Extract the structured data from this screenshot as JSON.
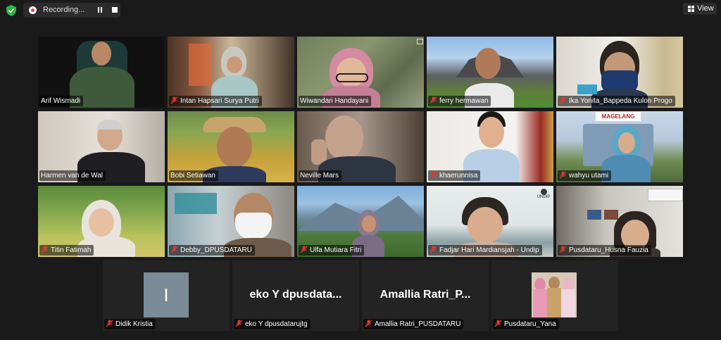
{
  "recording": {
    "label": "Recording..."
  },
  "view": {
    "label": "View"
  },
  "participants": [
    {
      "name": "Arif Wismadi",
      "muted": false
    },
    {
      "name": "Intan Hapsari Surya Putri",
      "muted": true
    },
    {
      "name": "Wiwandari Handayani",
      "muted": false
    },
    {
      "name": "ferry hermawan",
      "muted": true
    },
    {
      "name": "Ika Yonita_Bappeda Kulon Progo",
      "muted": true
    },
    {
      "name": "Harmen van de Wal",
      "muted": false
    },
    {
      "name": "Bobi Setiawan",
      "muted": false
    },
    {
      "name": "Neville Mars",
      "muted": false
    },
    {
      "name": "khaerunnisa",
      "muted": true
    },
    {
      "name": "wahyu utami",
      "muted": true
    },
    {
      "name": "Titin Fatimah",
      "muted": true
    },
    {
      "name": "Debby_DPUSDATARU",
      "muted": true
    },
    {
      "name": "Ulfa Mutiara Fitri",
      "muted": true
    },
    {
      "name": "Fadjar Hari Mardiansjah - Undip",
      "muted": true
    },
    {
      "name": "Pusdataru_Husna Fauzia",
      "muted": true
    }
  ],
  "bottom_row": [
    {
      "name": "Didik Kristia",
      "initial": "I",
      "muted": true
    },
    {
      "name": "eko Y dpusdatarujtg",
      "display": "eko Y dpusdata...",
      "muted": true
    },
    {
      "name": "Amallia Ratri_PUSDATARU",
      "display": "Amallia Ratri_P...",
      "muted": true
    },
    {
      "name": "Pusdataru_Yana",
      "muted": true
    }
  ],
  "tile_overlays": {
    "maggelang_sign": "MAGELANG",
    "undip_logo": "UNDIP"
  },
  "colors": {
    "active_speaker": "#b9dc3c",
    "recording_dot": "#e8423f",
    "muted_mic": "#e0372f"
  }
}
